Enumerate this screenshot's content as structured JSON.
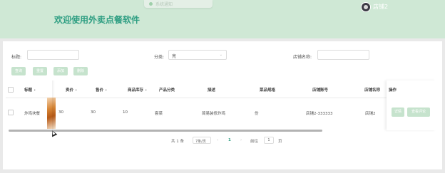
{
  "header": {
    "notice": "系统通知",
    "title": "欢迎使用外卖点餐软件",
    "user": "店铺2"
  },
  "filters": {
    "title_label": "标题:",
    "title_value": "",
    "category_label": "分类:",
    "category_value": "亮",
    "shop_label": "店铺名称:",
    "shop_value": ""
  },
  "buttons": {
    "query": "查询",
    "reset": "重置",
    "add": "添加",
    "delete": "删除"
  },
  "table": {
    "headers": {
      "title": "标题",
      "sales": "卖价",
      "price": "售价",
      "stock": "商品库存",
      "category": "产品分类",
      "desc": "描述",
      "spec": "菜品规格",
      "account": "店铺账号",
      "shopname": "店铺名称",
      "action": "操作"
    },
    "row": {
      "title": "炸鸡块餐",
      "sales": "30",
      "price": "30",
      "stock": "10",
      "category": "套菜",
      "desc": "简易装修炸鸡",
      "spec": "份",
      "account": "店铺2-333333",
      "shopname": "店铺2",
      "actions": {
        "detail": "详情",
        "review": "查看评论"
      }
    }
  },
  "pagination": {
    "total": "共 1 条",
    "size": "7条/页",
    "prev": "‹",
    "current": "1",
    "next": "›",
    "goto": "前往",
    "goto_value": "1",
    "page_suffix": "页"
  },
  "colors": {
    "header_bg": "#cfe8d5",
    "title": "#2e9e82",
    "button": "#c6e3cd",
    "page_active": "#2e9e82"
  },
  "icons": {
    "avatar": "user-avatar",
    "sort": "sort-icon",
    "select_arrow": "chevron-down-icon",
    "cursor": "mouse-pointer-icon"
  }
}
